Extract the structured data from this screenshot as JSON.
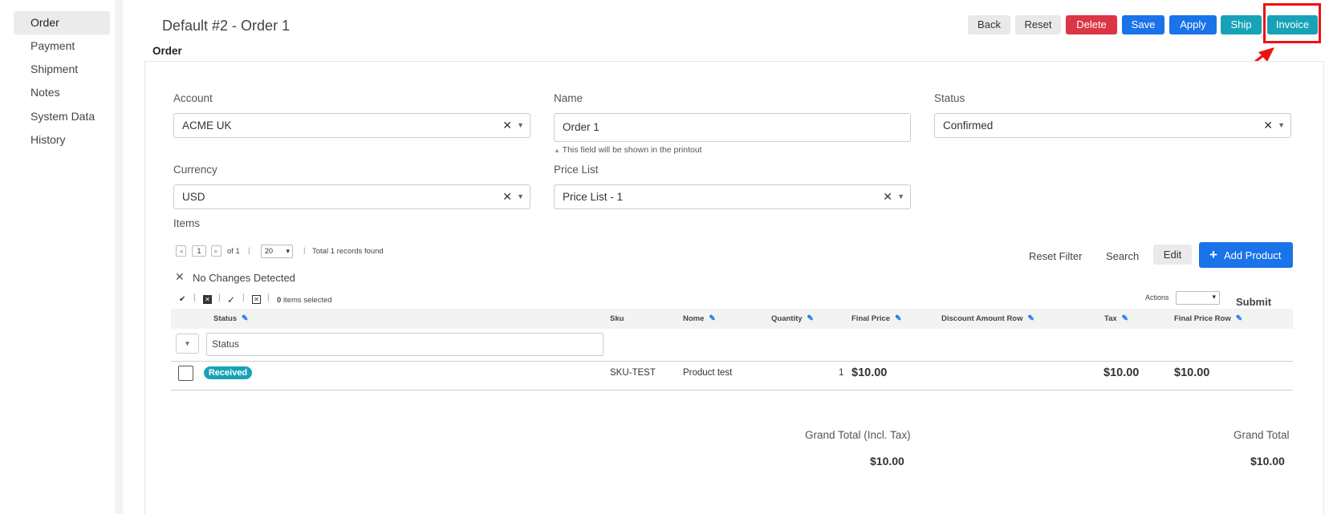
{
  "sidebar": {
    "items": [
      {
        "label": "Order"
      },
      {
        "label": "Payment"
      },
      {
        "label": "Shipment"
      },
      {
        "label": "Notes"
      },
      {
        "label": "System Data"
      },
      {
        "label": "History"
      }
    ]
  },
  "header": {
    "title": "Default #2 - Order 1",
    "section": "Order"
  },
  "toolbar": {
    "back": "Back",
    "reset": "Reset",
    "delete": "Delete",
    "save": "Save",
    "apply": "Apply",
    "ship": "Ship",
    "invoice": "Invoice"
  },
  "form": {
    "account": {
      "label": "Account",
      "value": "ACME UK"
    },
    "name": {
      "label": "Name",
      "value": "Order 1",
      "hint": "This field will be shown in the printout"
    },
    "status": {
      "label": "Status",
      "value": "Confirmed"
    },
    "currency": {
      "label": "Currency",
      "value": "USD"
    },
    "price_list": {
      "label": "Price List",
      "value": "Price List - 1"
    }
  },
  "items": {
    "label": "Items",
    "pager": {
      "page": "1",
      "of": "of 1",
      "page_size": "20",
      "total": "Total 1 records found"
    },
    "no_changes": "No Changes Detected",
    "selected_count": "0",
    "selected_suffix": "items selected",
    "actions_label": "Actions",
    "submit": "Submit",
    "reset_filter": "Reset Filter",
    "search": "Search",
    "edit": "Edit",
    "add_product": "Add Product",
    "columns": [
      "Status",
      "Sku",
      "Nome",
      "Quantity",
      "Final Price",
      "Discount Amount Row",
      "Tax",
      "Final Price Row"
    ],
    "status_filter_placeholder": "Status",
    "rows": [
      {
        "status": "Received",
        "sku": "SKU-TEST",
        "name": "Product test",
        "quantity": "1",
        "final_price": "$10.00",
        "tax": "$10.00",
        "final_price_row": "$10.00"
      }
    ]
  },
  "totals": {
    "grand_total_incl_tax_label": "Grand Total (Incl. Tax)",
    "grand_total_incl_tax": "$10.00",
    "grand_total_label": "Grand Total",
    "grand_total": "$10.00"
  },
  "colors": {
    "primary": "#1a73e8",
    "danger": "#dc3545",
    "info": "#17a2b8",
    "highlight": "#ee1111"
  }
}
